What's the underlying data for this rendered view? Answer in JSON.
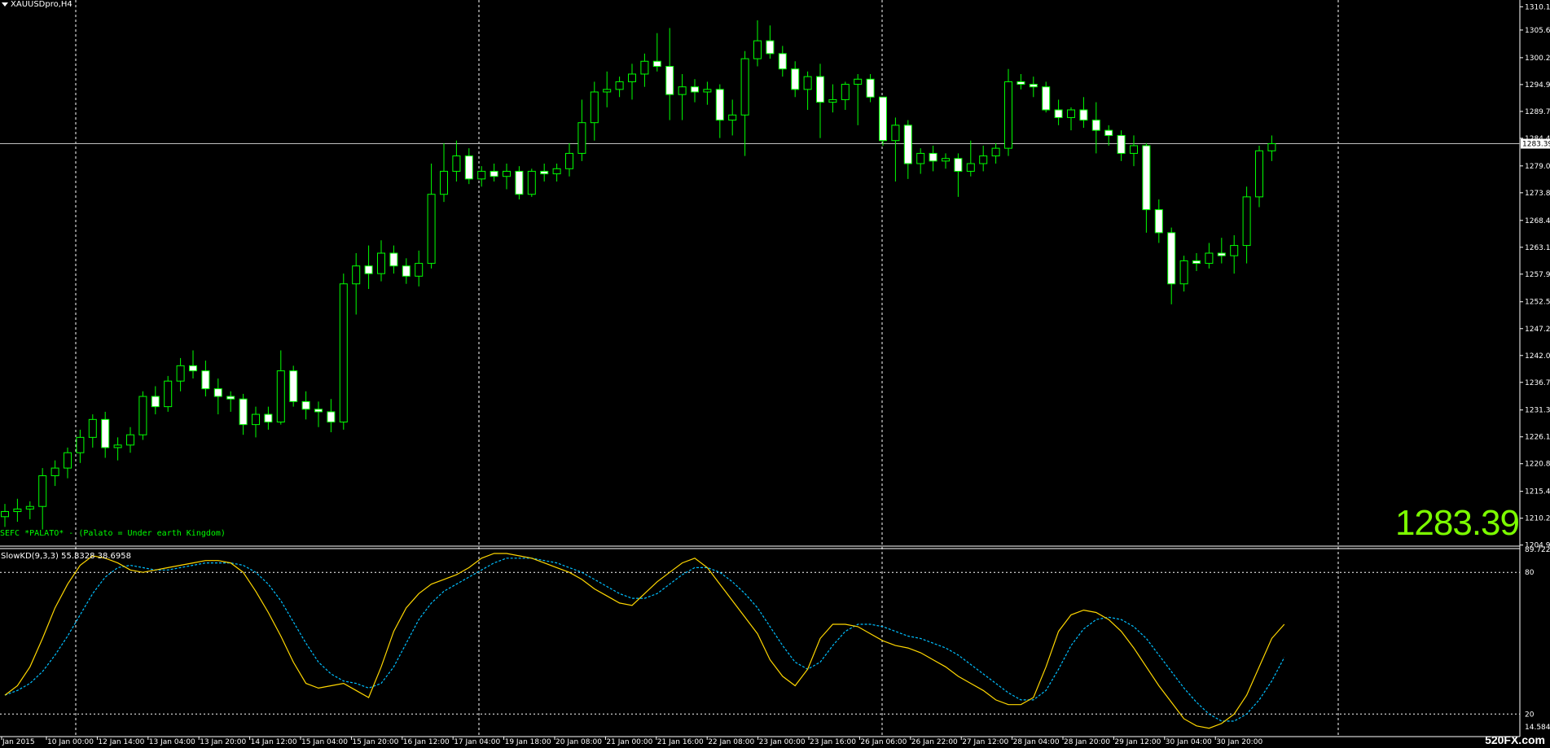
{
  "window": {
    "symbol_title": "XAUUSDpro,H4"
  },
  "indicator_note": "SEFC *PALATO* - (Palato = Under earth Kingdom)",
  "current_price": "1283.39",
  "oscillator": {
    "label": "SlowKD(9,3,3) 55.8328 38.6958"
  },
  "watermark": "520FX.com",
  "colors": {
    "background": "#000000",
    "bull": "#00ff00",
    "bear_body": "#ffffff",
    "k_line": "#ffd700",
    "d_line": "#00bfff",
    "grid": "#ffffff",
    "price_line": "#c0c0c0",
    "big_price": "#7cfc00"
  },
  "chart_data": {
    "type": "candlestick",
    "price_axis": {
      "ticks": [
        "1310.15",
        "1305.60",
        "1300.20",
        "1294.95",
        "1289.70",
        "1284.45",
        "1279.05",
        "1273.80",
        "1268.40",
        "1263.15",
        "1257.90",
        "1252.50",
        "1247.25",
        "1242.00",
        "1236.75",
        "1231.35",
        "1226.10",
        "1220.85",
        "1215.45",
        "1210.20",
        "1204.95"
      ],
      "range": [
        1204.9,
        1310.2
      ],
      "current": 1283.39
    },
    "time_axis": {
      "labels": [
        "Jan 2015",
        "10 Jan 00:00",
        "12 Jan 14:00",
        "13 Jan 04:00",
        "13 Jan 20:00",
        "14 Jan 12:00",
        "15 Jan 04:00",
        "15 Jan 20:00",
        "16 Jan 12:00",
        "17 Jan 04:00",
        "19 Jan 18:00",
        "20 Jan 08:00",
        "21 Jan 00:00",
        "21 Jan 16:00",
        "22 Jan 08:00",
        "23 Jan 00:00",
        "23 Jan 16:00",
        "26 Jan 06:00",
        "26 Jan 22:00",
        "27 Jan 12:00",
        "28 Jan 04:00",
        "28 Jan 20:00",
        "29 Jan 12:00",
        "30 Jan 04:00",
        "30 Jan 20:00"
      ]
    },
    "candles": [
      [
        1210.5,
        1213.0,
        1208.5,
        1211.5
      ],
      [
        1211.5,
        1214.0,
        1209.5,
        1212.0
      ],
      [
        1212.0,
        1213.5,
        1210.0,
        1212.5
      ],
      [
        1212.5,
        1220.0,
        1208.0,
        1218.5
      ],
      [
        1218.5,
        1221.5,
        1216.5,
        1220.0
      ],
      [
        1220.0,
        1224.0,
        1218.0,
        1223.0
      ],
      [
        1223.0,
        1227.5,
        1221.0,
        1226.0
      ],
      [
        1226.0,
        1230.5,
        1224.0,
        1229.5
      ],
      [
        1229.5,
        1231.0,
        1222.0,
        1224.0
      ],
      [
        1224.0,
        1226.0,
        1221.5,
        1224.5
      ],
      [
        1224.5,
        1228.0,
        1223.0,
        1226.5
      ],
      [
        1226.5,
        1235.0,
        1225.5,
        1234.0
      ],
      [
        1234.0,
        1236.0,
        1230.5,
        1232.0
      ],
      [
        1232.0,
        1238.0,
        1231.0,
        1237.0
      ],
      [
        1237.0,
        1241.5,
        1235.0,
        1240.0
      ],
      [
        1240.0,
        1243.0,
        1237.5,
        1239.0
      ],
      [
        1239.0,
        1241.0,
        1234.0,
        1235.5
      ],
      [
        1235.5,
        1237.5,
        1230.5,
        1234.0
      ],
      [
        1234.0,
        1235.0,
        1231.0,
        1233.5
      ],
      [
        1233.5,
        1234.5,
        1226.5,
        1228.5
      ],
      [
        1228.5,
        1232.0,
        1226.0,
        1230.5
      ],
      [
        1230.5,
        1232.0,
        1227.5,
        1229.0
      ],
      [
        1229.0,
        1243.0,
        1228.5,
        1239.0
      ],
      [
        1239.0,
        1240.0,
        1232.0,
        1233.0
      ],
      [
        1233.0,
        1235.0,
        1229.5,
        1231.5
      ],
      [
        1231.5,
        1233.0,
        1228.0,
        1231.0
      ],
      [
        1231.0,
        1233.5,
        1227.0,
        1229.0
      ],
      [
        1229.0,
        1258.0,
        1227.5,
        1256.0
      ],
      [
        1256.0,
        1262.0,
        1250.0,
        1259.5
      ],
      [
        1259.5,
        1263.5,
        1255.0,
        1258.0
      ],
      [
        1258.0,
        1264.5,
        1256.5,
        1262.0
      ],
      [
        1262.0,
        1263.5,
        1258.0,
        1259.5
      ],
      [
        1259.5,
        1261.0,
        1256.0,
        1257.5
      ],
      [
        1257.5,
        1262.5,
        1255.5,
        1260.0
      ],
      [
        1260.0,
        1279.5,
        1259.0,
        1273.5
      ],
      [
        1273.5,
        1283.5,
        1272.0,
        1278.0
      ],
      [
        1278.0,
        1284.0,
        1276.0,
        1281.0
      ],
      [
        1281.0,
        1282.5,
        1275.5,
        1276.5
      ],
      [
        1276.5,
        1279.0,
        1275.0,
        1278.0
      ],
      [
        1278.0,
        1279.5,
        1276.0,
        1277.0
      ],
      [
        1277.0,
        1279.5,
        1274.5,
        1278.0
      ],
      [
        1278.0,
        1279.0,
        1272.5,
        1273.5
      ],
      [
        1273.5,
        1278.5,
        1273.0,
        1278.0
      ],
      [
        1278.0,
        1279.5,
        1276.0,
        1277.5
      ],
      [
        1277.5,
        1279.5,
        1276.0,
        1278.5
      ],
      [
        1278.5,
        1283.5,
        1277.0,
        1281.5
      ],
      [
        1281.5,
        1292.0,
        1280.0,
        1287.5
      ],
      [
        1287.5,
        1295.5,
        1284.0,
        1293.5
      ],
      [
        1293.5,
        1297.5,
        1290.5,
        1294.0
      ],
      [
        1294.0,
        1296.5,
        1292.5,
        1295.5
      ],
      [
        1295.5,
        1299.0,
        1292.0,
        1297.0
      ],
      [
        1297.0,
        1301.0,
        1294.5,
        1299.5
      ],
      [
        1299.5,
        1305.0,
        1297.5,
        1298.5
      ],
      [
        1298.5,
        1306.0,
        1288.0,
        1293.0
      ],
      [
        1293.0,
        1297.0,
        1288.0,
        1294.5
      ],
      [
        1294.5,
        1296.0,
        1291.5,
        1293.5
      ],
      [
        1293.5,
        1295.5,
        1291.0,
        1294.0
      ],
      [
        1294.0,
        1295.0,
        1284.5,
        1288.0
      ],
      [
        1288.0,
        1292.0,
        1285.0,
        1289.0
      ],
      [
        1289.0,
        1301.5,
        1281.0,
        1300.0
      ],
      [
        1300.0,
        1307.5,
        1298.5,
        1303.5
      ],
      [
        1303.5,
        1306.5,
        1300.0,
        1301.0
      ],
      [
        1301.0,
        1302.5,
        1296.5,
        1298.0
      ],
      [
        1298.0,
        1299.5,
        1292.5,
        1294.0
      ],
      [
        1294.0,
        1297.5,
        1290.0,
        1296.5
      ],
      [
        1296.5,
        1299.0,
        1284.5,
        1291.5
      ],
      [
        1291.5,
        1295.0,
        1289.5,
        1292.0
      ],
      [
        1292.0,
        1295.5,
        1290.0,
        1295.0
      ],
      [
        1295.0,
        1297.0,
        1287.0,
        1296.0
      ],
      [
        1296.0,
        1297.0,
        1291.5,
        1292.5
      ],
      [
        1292.5,
        1292.5,
        1283.0,
        1284.0
      ],
      [
        1284.0,
        1288.5,
        1276.0,
        1287.0
      ],
      [
        1287.0,
        1288.0,
        1276.5,
        1279.5
      ],
      [
        1279.5,
        1282.5,
        1277.5,
        1281.5
      ],
      [
        1281.5,
        1283.0,
        1278.0,
        1280.0
      ],
      [
        1280.0,
        1281.5,
        1278.5,
        1280.5
      ],
      [
        1280.5,
        1281.5,
        1273.0,
        1278.0
      ],
      [
        1278.0,
        1284.0,
        1277.0,
        1279.5
      ],
      [
        1279.5,
        1283.0,
        1278.0,
        1281.0
      ],
      [
        1281.0,
        1283.5,
        1279.5,
        1282.5
      ],
      [
        1282.5,
        1298.0,
        1281.0,
        1295.5
      ],
      [
        1295.5,
        1297.0,
        1294.0,
        1295.0
      ],
      [
        1295.0,
        1296.5,
        1292.5,
        1294.5
      ],
      [
        1294.5,
        1295.5,
        1289.5,
        1290.0
      ],
      [
        1290.0,
        1292.0,
        1287.0,
        1288.5
      ],
      [
        1288.5,
        1290.5,
        1286.0,
        1290.0
      ],
      [
        1290.0,
        1292.5,
        1286.5,
        1288.0
      ],
      [
        1288.0,
        1291.5,
        1281.5,
        1286.0
      ],
      [
        1286.0,
        1287.0,
        1283.0,
        1285.0
      ],
      [
        1285.0,
        1286.0,
        1280.0,
        1281.5
      ],
      [
        1281.5,
        1285.0,
        1279.0,
        1283.0
      ],
      [
        1283.0,
        1283.5,
        1266.0,
        1270.5
      ],
      [
        1270.5,
        1272.5,
        1264.0,
        1266.0
      ],
      [
        1266.0,
        1267.0,
        1252.0,
        1256.0
      ],
      [
        1256.0,
        1261.5,
        1254.5,
        1260.5
      ],
      [
        1260.5,
        1262.0,
        1258.5,
        1260.0
      ],
      [
        1260.0,
        1264.0,
        1259.0,
        1262.0
      ],
      [
        1262.0,
        1265.0,
        1260.0,
        1261.5
      ],
      [
        1261.5,
        1265.5,
        1258.0,
        1263.5
      ],
      [
        1263.5,
        1275.0,
        1260.0,
        1273.0
      ],
      [
        1273.0,
        1283.0,
        1271.0,
        1282.0
      ],
      [
        1282.0,
        1285.0,
        1280.0,
        1283.39
      ]
    ],
    "oscillator": {
      "name": "SlowKD(9,3,3)",
      "levels": [
        80,
        20
      ],
      "range": [
        14.5846,
        89.7226
      ],
      "axis_labels": [
        "89.7226",
        "80",
        "20",
        "14.5846"
      ],
      "k": [
        28,
        32,
        40,
        52,
        65,
        75,
        83,
        87,
        86,
        84,
        81,
        80,
        81,
        82,
        83,
        84,
        85,
        85,
        84,
        80,
        72,
        63,
        53,
        42,
        33,
        31,
        32,
        33,
        30,
        27,
        40,
        55,
        65,
        71,
        75,
        77,
        79,
        82,
        86,
        88,
        88,
        87,
        86,
        84,
        82,
        80,
        77,
        73,
        70,
        67,
        66,
        71,
        76,
        80,
        84,
        86,
        82,
        75,
        68,
        61,
        54,
        43,
        36,
        32,
        39,
        52,
        58,
        58,
        57,
        54,
        51,
        49,
        48,
        46,
        43,
        40,
        36,
        33,
        30,
        26,
        24,
        24,
        27,
        40,
        55,
        62,
        64,
        63,
        60,
        55,
        48,
        40,
        32,
        25,
        18,
        15,
        14,
        16,
        20,
        28,
        40,
        52,
        58
      ],
      "d": [
        28,
        30,
        33,
        38,
        45,
        53,
        62,
        71,
        78,
        82,
        83,
        82,
        81,
        81,
        82,
        83,
        84,
        84,
        84,
        83,
        80,
        75,
        68,
        59,
        50,
        42,
        37,
        34,
        33,
        31,
        33,
        40,
        50,
        60,
        67,
        72,
        75,
        78,
        81,
        84,
        86,
        86,
        86,
        85,
        84,
        82,
        80,
        77,
        74,
        71,
        69,
        69,
        71,
        75,
        79,
        82,
        82,
        80,
        76,
        71,
        65,
        57,
        49,
        42,
        39,
        42,
        49,
        55,
        58,
        58,
        57,
        55,
        53,
        52,
        50,
        48,
        45,
        41,
        37,
        33,
        29,
        26,
        26,
        30,
        39,
        49,
        56,
        60,
        61,
        60,
        57,
        52,
        45,
        38,
        31,
        25,
        20,
        17,
        17,
        20,
        26,
        34,
        44
      ]
    }
  }
}
